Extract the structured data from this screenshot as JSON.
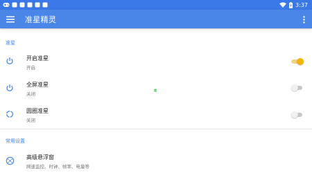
{
  "status_bar": {
    "time": "3:37",
    "icons": [
      "gamepad-icon",
      "notification-square-icon",
      "notification-square-icon",
      "notification-square-icon",
      "notification-square-icon",
      "notification-square-icon",
      "wifi-icon",
      "battery-charging-icon"
    ]
  },
  "app_bar": {
    "title": "准星精灵",
    "menu_icon": "hamburger-menu-icon",
    "more_icon": "more-vert-icon"
  },
  "sections": [
    {
      "header": "准星",
      "items": [
        {
          "title": "开启准星",
          "subtitle": "开启",
          "icon": "power-icon",
          "toggle": true
        },
        {
          "title": "全屏准星",
          "subtitle": "关闭",
          "icon": "power-icon",
          "toggle": false
        },
        {
          "title": "圆圈准星",
          "subtitle": "关闭",
          "icon": "circle-icon",
          "toggle": false
        }
      ]
    },
    {
      "header": "常用设置",
      "items": [
        {
          "title": "高级悬浮窗",
          "subtitle": "网速监控、时钟、帧率、电量等",
          "icon": "floating-window-icon"
        }
      ]
    }
  ],
  "overlay_marker": "8",
  "colors": {
    "status_bar": "#3B78E7",
    "app_bar": "#4A86E8",
    "accent": "#4A86E8",
    "toggle_on": "#F4B400",
    "toggle_off": "#C8C8C8"
  }
}
